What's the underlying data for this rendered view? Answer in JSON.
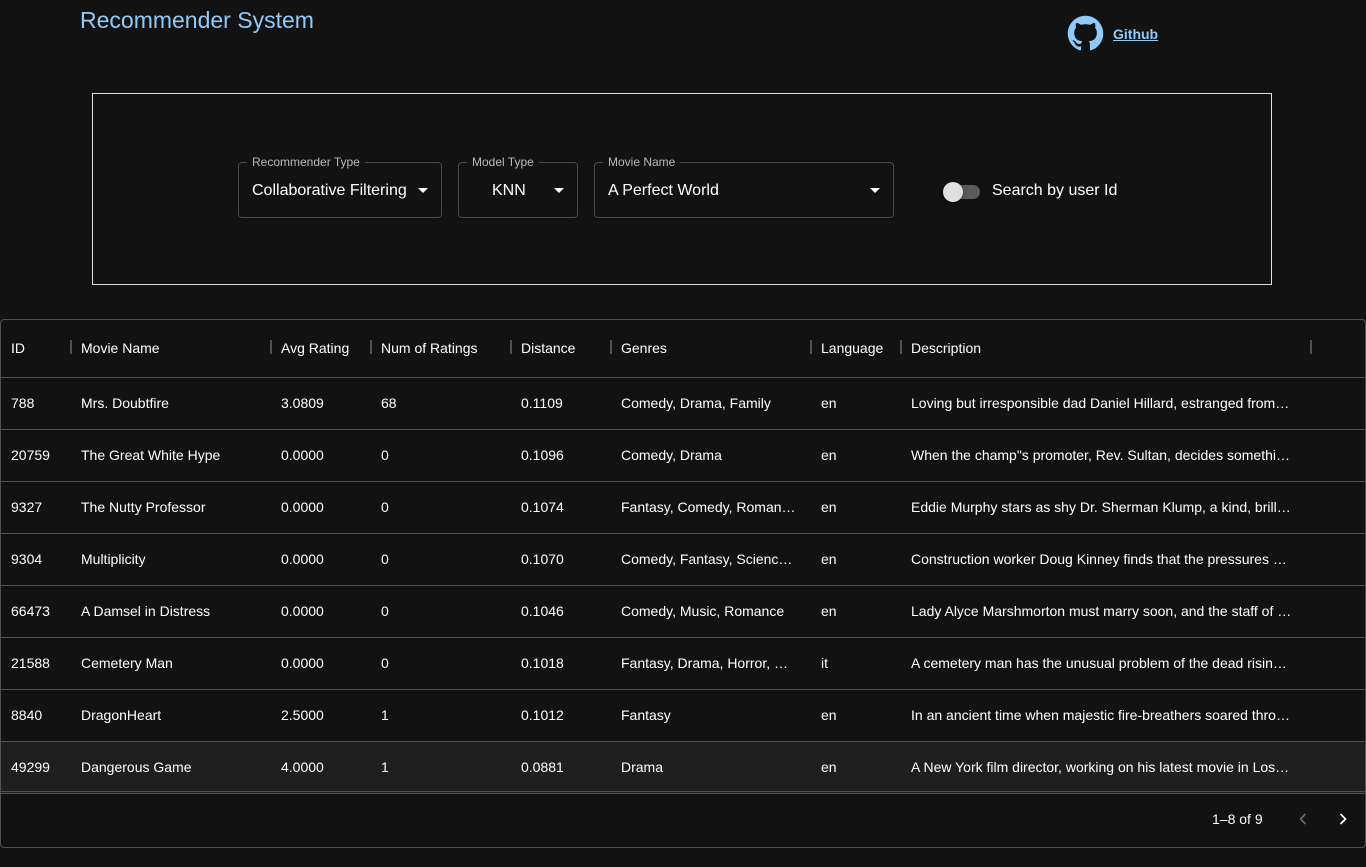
{
  "app": {
    "title": "Recommender System"
  },
  "header": {
    "github_label": "Github"
  },
  "filters": {
    "recommender_type": {
      "label": "Recommender Type",
      "value": "Collaborative Filtering"
    },
    "model_type": {
      "label": "Model Type",
      "value": "KNN"
    },
    "movie_name": {
      "label": "Movie Name",
      "value": "A Perfect World"
    },
    "user_id_switch": {
      "label": "Search by user Id",
      "checked": false
    }
  },
  "table": {
    "columns": [
      "ID",
      "Movie Name",
      "Avg Rating",
      "Num of Ratings",
      "Distance",
      "Genres",
      "Language",
      "Description"
    ],
    "rows": [
      [
        "788",
        "Mrs. Doubtfire",
        "3.0809",
        "68",
        "0.1109",
        "Comedy, Drama, Family",
        "en",
        "Loving but irresponsible dad Daniel Hillard, estranged from…"
      ],
      [
        "20759",
        "The Great White Hype",
        "0.0000",
        "0",
        "0.1096",
        "Comedy, Drama",
        "en",
        "When the champ\"s promoter, Rev. Sultan, decides somethi…"
      ],
      [
        "9327",
        "The Nutty Professor",
        "0.0000",
        "0",
        "0.1074",
        "Fantasy, Comedy, Roman…",
        "en",
        "Eddie Murphy stars as shy Dr. Sherman Klump, a kind, brill…"
      ],
      [
        "9304",
        "Multiplicity",
        "0.0000",
        "0",
        "0.1070",
        "Comedy, Fantasy, Scienc…",
        "en",
        "Construction worker Doug Kinney finds that the pressures …"
      ],
      [
        "66473",
        "A Damsel in Distress",
        "0.0000",
        "0",
        "0.1046",
        "Comedy, Music, Romance",
        "en",
        "Lady Alyce Marshmorton must marry soon, and the staff of …"
      ],
      [
        "21588",
        "Cemetery Man",
        "0.0000",
        "0",
        "0.1018",
        "Fantasy, Drama, Horror, …",
        "it",
        "A cemetery man has the unusual problem of the dead risin…"
      ],
      [
        "8840",
        "DragonHeart",
        "2.5000",
        "1",
        "0.1012",
        "Fantasy",
        "en",
        "In an ancient time when majestic fire-breathers soared thro…"
      ],
      [
        "49299",
        "Dangerous Game",
        "4.0000",
        "1",
        "0.0881",
        "Drama",
        "en",
        "A New York film director, working on his latest movie in Los…"
      ]
    ],
    "selected_row": 7
  },
  "pagination": {
    "text": "1–8 of 9"
  },
  "colors": {
    "accent": "#90caf9",
    "background": "#121212",
    "border": "#515151"
  },
  "icons": {
    "github": "github-icon",
    "prev": "chevron-left-icon",
    "next": "chevron-right-icon",
    "dropdown": "arrow-drop-down-icon"
  }
}
